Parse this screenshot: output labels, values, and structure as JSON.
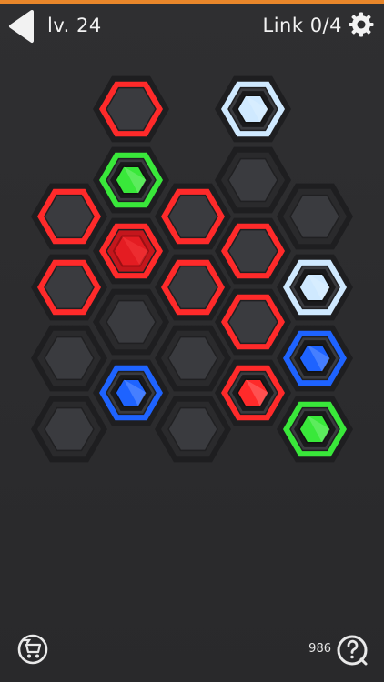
{
  "header": {
    "level_label": "lv. 24",
    "link_label": "Link 0/4"
  },
  "footer": {
    "coins": "986"
  },
  "colors": {
    "accent": "#e8862a",
    "red": "#ff2a2a",
    "green": "#39e83a",
    "blue": "#1e63ff",
    "light_blue": "#cfe9ff",
    "cell": "#3a3b3f",
    "cell_border": "#1e1e20"
  },
  "board": {
    "cells": [
      {
        "col": 0,
        "row": 0,
        "ring": "red"
      },
      {
        "col": 0,
        "row": 1,
        "ring": "red"
      },
      {
        "col": 0,
        "row": 2,
        "ring": "none"
      },
      {
        "col": 0,
        "row": 3,
        "ring": "none"
      },
      {
        "col": 1,
        "row": -1,
        "ring": "red"
      },
      {
        "col": 1,
        "row": 0,
        "ring": "green",
        "node": "green"
      },
      {
        "col": 1,
        "row": 1,
        "ring": "red",
        "node": "red",
        "filled": true
      },
      {
        "col": 1,
        "row": 2,
        "ring": "none"
      },
      {
        "col": 1,
        "row": 3,
        "ring": "blue",
        "node": "blue"
      },
      {
        "col": 2,
        "row": 0,
        "ring": "red"
      },
      {
        "col": 2,
        "row": 1,
        "ring": "red"
      },
      {
        "col": 2,
        "row": 2,
        "ring": "none"
      },
      {
        "col": 2,
        "row": 3,
        "ring": "none"
      },
      {
        "col": 3,
        "row": -1,
        "ring": "light_blue",
        "node": "light_blue"
      },
      {
        "col": 3,
        "row": 0,
        "ring": "none"
      },
      {
        "col": 3,
        "row": 1,
        "ring": "red"
      },
      {
        "col": 3,
        "row": 2,
        "ring": "red"
      },
      {
        "col": 3,
        "row": 3,
        "ring": "red",
        "node": "red"
      },
      {
        "col": 4,
        "row": 0,
        "ring": "none"
      },
      {
        "col": 4,
        "row": 1,
        "ring": "light_blue",
        "node": "light_blue"
      },
      {
        "col": 4,
        "row": 2,
        "ring": "blue",
        "node": "blue"
      },
      {
        "col": 4,
        "row": 3,
        "ring": "green",
        "node": "green"
      }
    ]
  },
  "icons": {
    "back": "back-arrow-icon",
    "settings": "gear-icon",
    "shop": "cart-icon",
    "hint": "hint-icon"
  }
}
